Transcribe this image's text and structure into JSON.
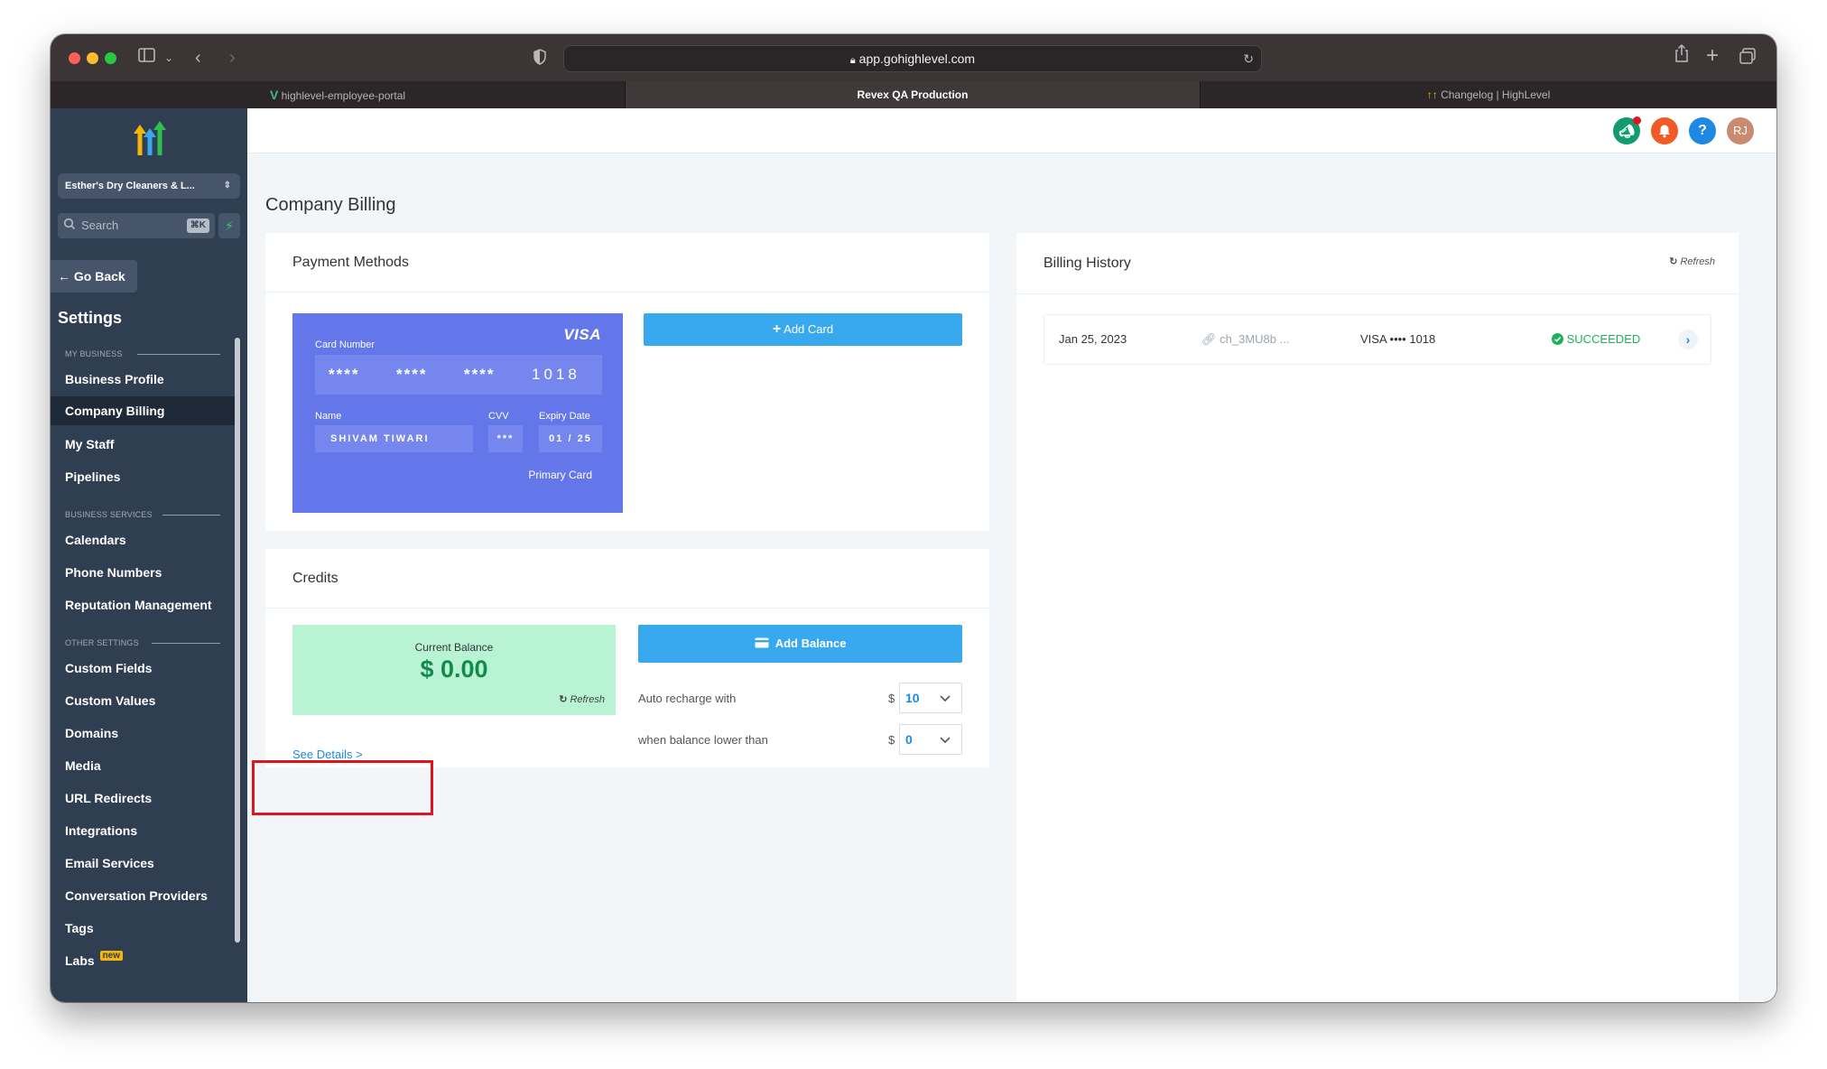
{
  "browser": {
    "url": "app.gohighlevel.com",
    "tabs": [
      {
        "label": "highlevel-employee-portal"
      },
      {
        "label": "Revex QA Production"
      },
      {
        "label": "Changelog | HighLevel"
      }
    ]
  },
  "sidebar": {
    "account_name": "Esther's Dry Cleaners & L...",
    "search_placeholder": "Search",
    "search_shortcut": "⌘K",
    "go_back": "Go Back",
    "title": "Settings",
    "sections": {
      "my_business": "MY BUSINESS",
      "business_services": "BUSINESS SERVICES",
      "other_settings": "OTHER SETTINGS"
    },
    "items": [
      {
        "label": "Business Profile"
      },
      {
        "label": "Company Billing"
      },
      {
        "label": "My Staff"
      },
      {
        "label": "Pipelines"
      },
      {
        "label": "Calendars"
      },
      {
        "label": "Phone Numbers"
      },
      {
        "label": "Reputation Management"
      },
      {
        "label": "Custom Fields"
      },
      {
        "label": "Custom Values"
      },
      {
        "label": "Domains"
      },
      {
        "label": "Media"
      },
      {
        "label": "URL Redirects"
      },
      {
        "label": "Integrations"
      },
      {
        "label": "Email Services"
      },
      {
        "label": "Conversation Providers"
      },
      {
        "label": "Tags"
      },
      {
        "label": "Labs"
      }
    ],
    "labs_badge": "new"
  },
  "header": {
    "avatar_initials": "RJ",
    "help_icon": "?"
  },
  "page": {
    "title": "Company Billing"
  },
  "payment_methods": {
    "title": "Payment Methods",
    "add_card": "Add Card",
    "card": {
      "brand": "VISA",
      "number_label": "Card Number",
      "groups": [
        "****",
        "****",
        "****",
        "1018"
      ],
      "name_label": "Name",
      "name": "SHIVAM TIWARI",
      "cvv_label": "CVV",
      "cvv": "***",
      "expiry_label": "Expiry Date",
      "expiry": "01 / 25",
      "primary": "Primary Card"
    }
  },
  "credits": {
    "title": "Credits",
    "balance_label": "Current Balance",
    "balance": "$ 0.00",
    "refresh": "Refresh",
    "add_balance": "Add Balance",
    "auto_recharge_label": "Auto recharge with",
    "auto_recharge_currency": "$",
    "auto_recharge_value": "10",
    "threshold_label": "when balance lower than",
    "threshold_currency": "$",
    "threshold_value": "0",
    "see_details": "See Details >"
  },
  "billing_history": {
    "title": "Billing History",
    "refresh": "Refresh",
    "rows": [
      {
        "date": "Jan 25, 2023",
        "charge_id": "ch_3MU8b ...",
        "card": "VISA •••• 1018",
        "status": "SUCCEEDED"
      }
    ]
  },
  "colors": {
    "sidebar_bg": "#2f3e51",
    "accent_blue": "#38a9ef",
    "visa_card": "#6477ea",
    "balance_bg": "#b8f4d4",
    "success_green": "#1fb05c",
    "highlight_red": "#e0141e"
  }
}
